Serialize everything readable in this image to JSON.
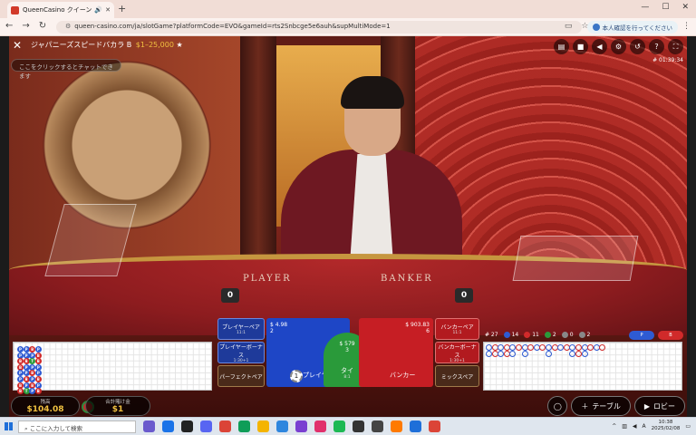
{
  "browser": {
    "tab_title": "QueenCasino クイーンカジノ",
    "url": "queen-casino.com/ja/slotGame?platformCode=EVO&gameId=rts2Snbcge5e6auh&supMultiMode=1",
    "profile_label": "本人確認を行ってください"
  },
  "game": {
    "title": "ジャパニーズスピードバカラ B",
    "limits": "$1–25,000",
    "chat_placeholder": "ここをクリックするとチャットできます",
    "timecode": "# 01:39:34",
    "player_label": "PLAYER",
    "banker_label": "BANKER",
    "player_score": "0",
    "banker_score": "0"
  },
  "bets": {
    "player_pair": "プレイヤーペア",
    "player_pair_odds": "11:1",
    "player_bonus": "プレイヤーボーナス",
    "player_bonus_odds": "1:30+1",
    "perfect_pair": "パーフェクトペア",
    "player_amount": "$ 4.98",
    "player_count": "2",
    "player": "プレイヤー",
    "tie_amount": "$ 579",
    "tie_count": "3",
    "tie": "タイ",
    "tie_odds": "8:1",
    "banker_amount": "$ 903.83",
    "banker_count": "6",
    "banker": "バンカー",
    "banker_pair": "バンカーペア",
    "banker_pair_odds": "11:1",
    "banker_bonus": "バンカーボーナス",
    "banker_bonus_odds": "1:30+1",
    "mix_pair": "ミックスペア",
    "chip": "1"
  },
  "stats": {
    "rounds": "# 27",
    "player_wins": "14",
    "banker_wins": "11",
    "ties": "2",
    "player_pairs": "0",
    "banker_pairs": "2",
    "p_predict": "P",
    "b_predict": "B"
  },
  "bead_road": [
    [
      "P",
      "P",
      "B",
      "B",
      "P",
      "P",
      "B",
      "B"
    ],
    [
      "P",
      "P",
      "B",
      "P",
      "P",
      "B",
      "P",
      "T"
    ],
    [
      "B",
      "P",
      "T",
      "P",
      "B",
      "P",
      "B",
      "P"
    ],
    [
      "P",
      "B",
      "B",
      "P",
      "P",
      "B",
      "P",
      "B"
    ]
  ],
  "wallet": {
    "balance_label": "残高",
    "balance": "$104.08",
    "total_bet_label": "合計賭け金",
    "total_bet": "$1"
  },
  "buttons": {
    "table": "テーブル",
    "lobby": "ロビー"
  },
  "taskbar": {
    "search_placeholder": "ここに入力して検索",
    "time": "10:38",
    "date": "2025/02/08"
  }
}
